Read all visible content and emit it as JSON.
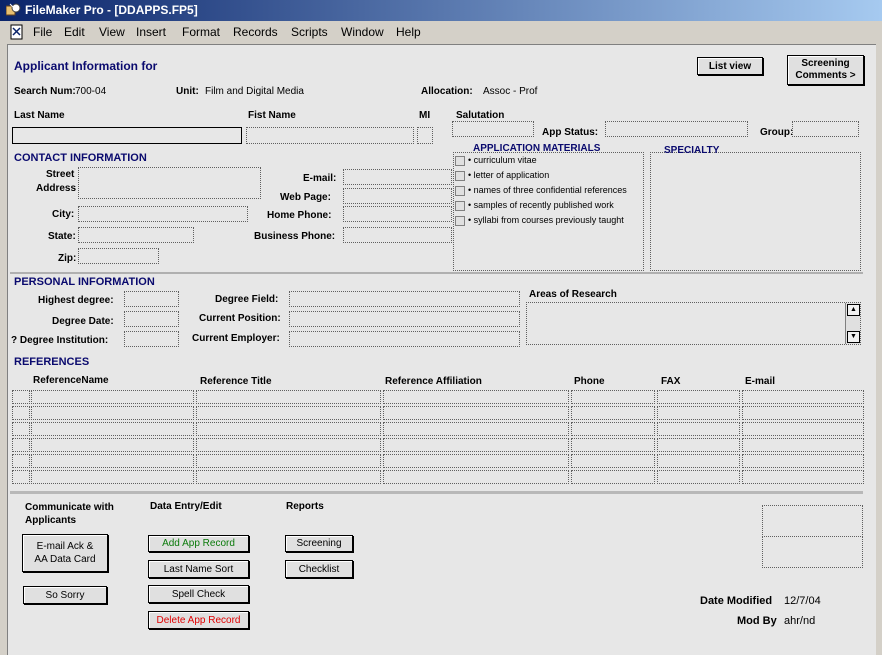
{
  "window": {
    "title": "FileMaker Pro - [DDAPPS.FP5]"
  },
  "menu": [
    "File",
    "Edit",
    "View",
    "Insert",
    "Format",
    "Records",
    "Scripts",
    "Window",
    "Help"
  ],
  "header": {
    "title": "Applicant Information for",
    "search_num_label": "Search Num:",
    "search_num_value": "700-04",
    "unit_label": "Unit:",
    "unit_value": "Film and Digital Media",
    "allocation_label": "Allocation:",
    "allocation_value": "Assoc - Prof",
    "list_view_btn": "List view",
    "screening_btn_line1": "Screening",
    "screening_btn_line2": "Comments >"
  },
  "name_labels": {
    "last": "Last Name",
    "first": "Fist Name",
    "mi": "MI",
    "salutation": "Salutation",
    "app_status": "App Status:",
    "group": "Group:"
  },
  "contact": {
    "section": "CONTACT INFORMATION",
    "street": "Street",
    "address": "Address",
    "city": "City:",
    "state": "State:",
    "zip": "Zip:",
    "email": "E-mail:",
    "web": "Web Page:",
    "home_phone": "Home Phone:",
    "business_phone": "Business Phone:"
  },
  "app_materials": {
    "title": "APPLICATION MATERIALS",
    "items": [
      "• curriculum vitae",
      "• letter of application",
      "• names of three confidential references",
      "• samples of recently published work",
      "• syllabi from courses previously taught"
    ]
  },
  "specialty": {
    "title": "SPECIALTY"
  },
  "personal": {
    "section": "PERSONAL INFORMATION",
    "highest_degree": "Highest degree:",
    "degree_date": "Degree Date:",
    "degree_institution": "? Degree Institution:",
    "degree_field": "Degree Field:",
    "current_position": "Current Position:",
    "current_employer": "Current Employer:",
    "areas_of_research": "Areas of Research"
  },
  "references": {
    "section": "REFERENCES",
    "columns": [
      "ReferenceName",
      "Reference Title",
      "Reference Affiliation",
      "Phone",
      "FAX",
      "E-mail"
    ]
  },
  "actions": {
    "communicate_title": "Communicate with Applicants",
    "data_entry_title": "Data Entry/Edit",
    "reports_title": "Reports",
    "email_ack_line1": "E-mail Ack &",
    "email_ack_line2": "AA Data Card",
    "so_sorry": "So Sorry",
    "add_record": "Add App Record",
    "last_name_sort": "Last Name Sort",
    "spell_check": "Spell Check",
    "delete_record": "Delete App Record",
    "screening": "Screening",
    "checklist": "Checklist"
  },
  "footer": {
    "date_modified_label": "Date Modified",
    "date_modified_value": "12/7/04",
    "mod_by_label": "Mod By",
    "mod_by_value": "ahr/nd"
  },
  "colors": {
    "add_record": "#0a7a0a",
    "delete_record": "#e00000",
    "titlebar_start": "#0a246a"
  }
}
